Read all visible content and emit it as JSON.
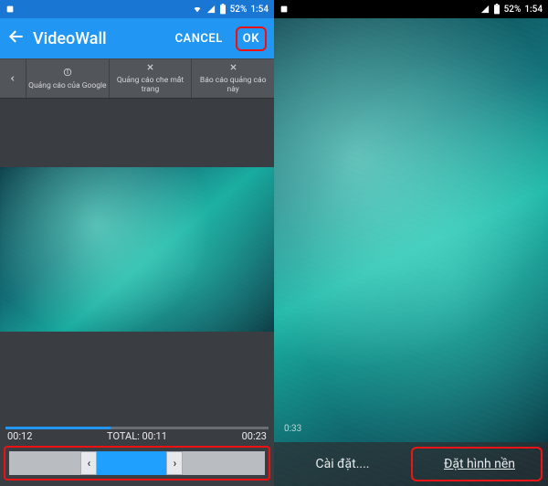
{
  "left": {
    "status": {
      "battery_pct": "52%",
      "time": "1:54"
    },
    "appbar": {
      "title": "VideoWall",
      "cancel": "CANCEL",
      "ok": "OK"
    },
    "ads": {
      "a": "Quảng cáo của Google",
      "b": "Quảng cáo che mắt trang",
      "c": "Báo cáo quảng cáo này"
    },
    "timeline": {
      "start": "00:12",
      "total_label": "TOTAL:",
      "total_value": "00:11",
      "end": "00:23"
    }
  },
  "right": {
    "status": {
      "battery_pct": "52%",
      "time": "1:54"
    },
    "overlay_time": "0:33",
    "actions": {
      "settings": "Cài đặt....",
      "set": "Đặt hình nền"
    }
  }
}
